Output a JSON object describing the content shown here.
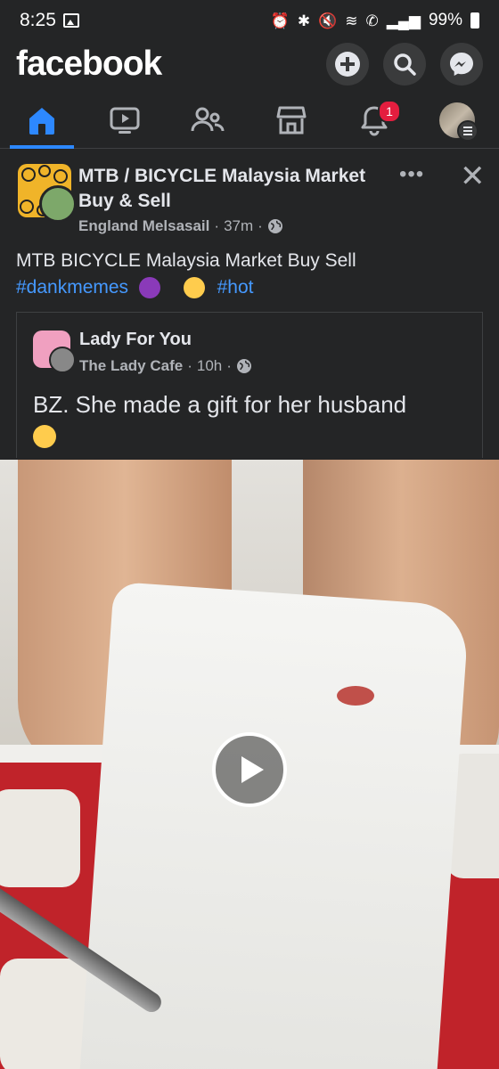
{
  "status": {
    "time": "8:25",
    "battery": "99%"
  },
  "header": {
    "logo": "facebook"
  },
  "nav": {
    "notification_count": "1"
  },
  "post": {
    "group_name": "MTB / BICYCLE Malaysia Market Buy & Sell",
    "author": "England Melsasail",
    "time": "37m",
    "text": "MTB   BICYCLE Malaysia Market Buy   Sell",
    "hashtag1": "#dankmemes",
    "hashtag2": "#hot"
  },
  "shared": {
    "page_name": "Lady For You",
    "author": "The Lady Cafe",
    "time": "10h",
    "text": "BZ. She made a gift for her husband"
  },
  "colors": {
    "accent": "#2d88ff",
    "link": "#4599ff",
    "badge": "#e41e3f",
    "background": "#242526"
  }
}
